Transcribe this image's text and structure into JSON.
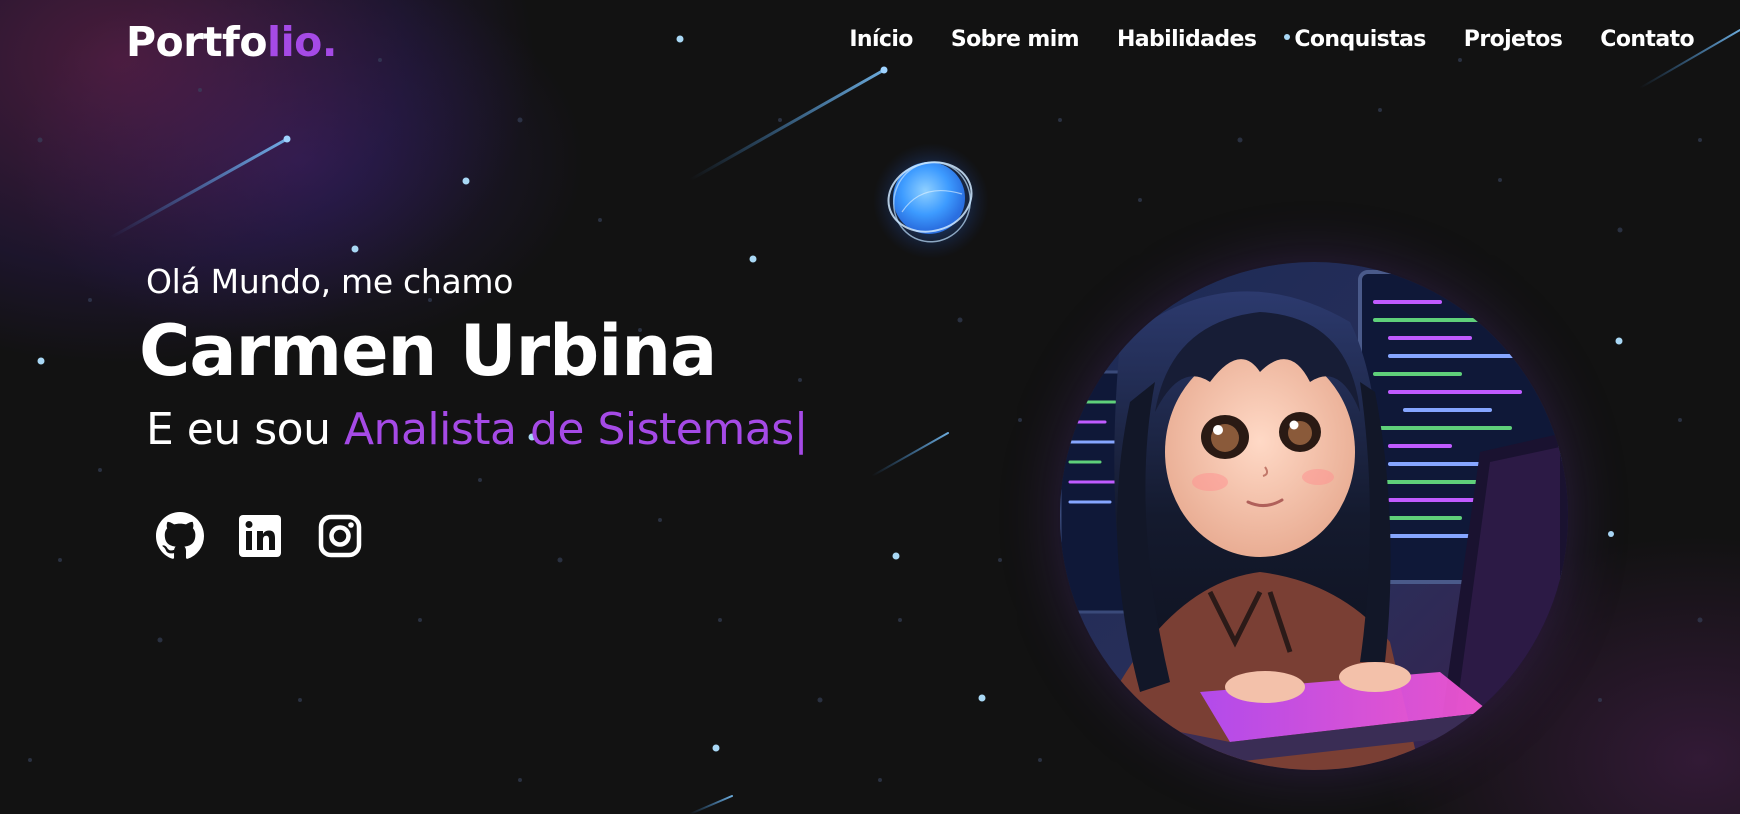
{
  "header": {
    "logo_main": "Portfo",
    "logo_accent": "lio."
  },
  "nav": {
    "items": [
      {
        "label": "Início"
      },
      {
        "label": "Sobre mim"
      },
      {
        "label": "Habilidades"
      },
      {
        "label": "Conquistas"
      },
      {
        "label": "Projetos"
      },
      {
        "label": "Contato"
      }
    ]
  },
  "hero": {
    "greeting": "Olá Mundo, me chamo",
    "name": "Carmen Urbina",
    "role_prefix": "E eu sou ",
    "role": "Analista de Sistemas",
    "cursor": "|"
  },
  "socials": [
    {
      "icon": "github-icon"
    },
    {
      "icon": "linkedin-icon"
    },
    {
      "icon": "instagram-icon"
    }
  ],
  "colors": {
    "background": "#121212",
    "accent": "#a54ae6",
    "text": "#ffffff",
    "star": "#a9d8f5"
  }
}
